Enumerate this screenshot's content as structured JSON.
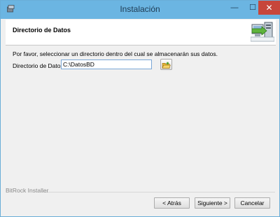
{
  "window": {
    "title": "Instalación",
    "min_glyph": "—",
    "max_glyph": "☐",
    "close_glyph": "✕"
  },
  "header": {
    "title": "Directorio de Datos"
  },
  "content": {
    "instruction": "Por favor, seleccionar un directorio dentro del cual se almacenarán sus datos.",
    "field_label": "Directorio de Datos",
    "field_value": "C:\\DatosBD"
  },
  "footer": {
    "brand": "BitRock Installer",
    "back_label": "< Atrás",
    "next_label": "Siguiente >",
    "cancel_label": "Cancelar"
  },
  "icons": {
    "app": "installer-icon",
    "browse": "folder-open-icon",
    "header_art": "computer-install-icon"
  }
}
